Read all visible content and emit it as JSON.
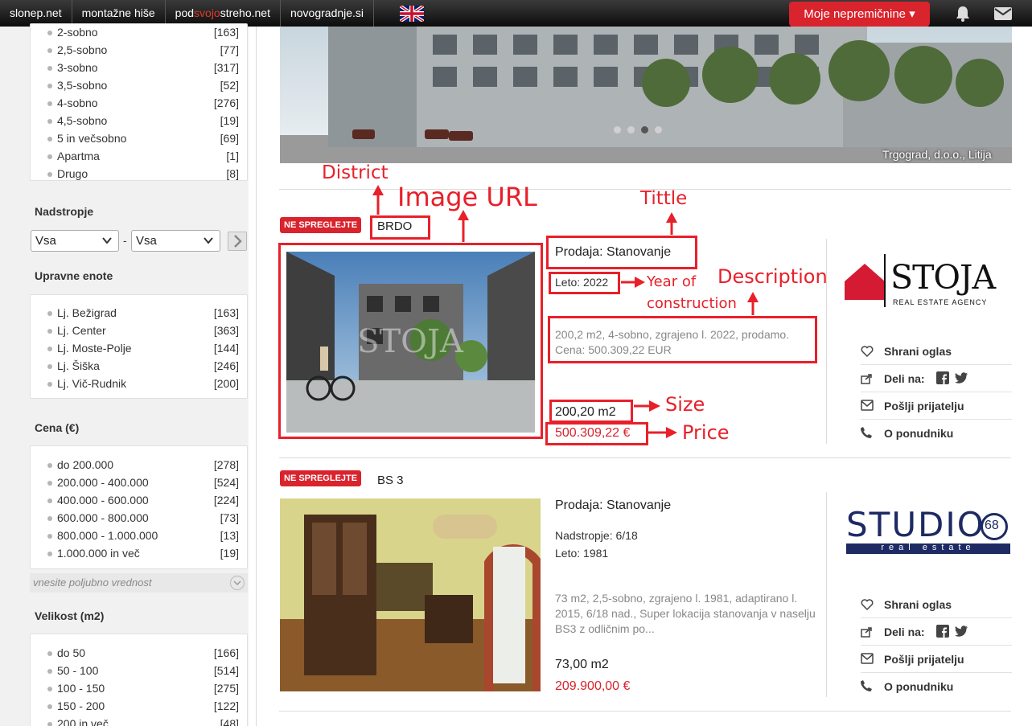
{
  "topbar": {
    "links": [
      "slonep.net",
      "montažne hiše",
      "novogradnje.si"
    ],
    "podsvojo": {
      "a": "pod",
      "b": "svojo",
      "c": "streho.net"
    },
    "moje_label": "Moje nepremičnine",
    "colors": {
      "accent": "#d9232d"
    }
  },
  "sidebar": {
    "room_types": [
      {
        "label": "2-sobno",
        "count": "[163]"
      },
      {
        "label": "2,5-sobno",
        "count": "[77]"
      },
      {
        "label": "3-sobno",
        "count": "[317]"
      },
      {
        "label": "3,5-sobno",
        "count": "[52]"
      },
      {
        "label": "4-sobno",
        "count": "[276]"
      },
      {
        "label": "4,5-sobno",
        "count": "[19]"
      },
      {
        "label": "5 in večsobno",
        "count": "[69]"
      },
      {
        "label": "Apartma",
        "count": "[1]"
      },
      {
        "label": "Drugo",
        "count": "[8]"
      }
    ],
    "floor_heading": "Nadstropje",
    "floor_from": "Vsa",
    "floor_sep": "-",
    "floor_to": "Vsa",
    "admin_heading": "Upravne enote",
    "admin_units": [
      {
        "label": "Lj. Bežigrad",
        "count": "[163]"
      },
      {
        "label": "Lj. Center",
        "count": "[363]"
      },
      {
        "label": "Lj. Moste-Polje",
        "count": "[144]"
      },
      {
        "label": "Lj. Šiška",
        "count": "[246]"
      },
      {
        "label": "Lj. Vič-Rudnik",
        "count": "[200]"
      }
    ],
    "price_heading": "Cena (€)",
    "price_ranges": [
      {
        "label": "do  200.000",
        "count": "[278]"
      },
      {
        "label": "200.000 - 400.000",
        "count": "[524]"
      },
      {
        "label": "400.000 - 600.000",
        "count": "[224]"
      },
      {
        "label": "600.000 - 800.000",
        "count": "[73]"
      },
      {
        "label": "800.000 - 1.000.000",
        "count": "[13]"
      },
      {
        "label": "1.000.000  in več",
        "count": "[19]"
      }
    ],
    "custom_price_placeholder": "vnesite poljubno vrednost",
    "size_heading": "Velikost (m2)",
    "size_ranges": [
      {
        "label": "do  50",
        "count": "[166]"
      },
      {
        "label": "50 - 100",
        "count": "[514]"
      },
      {
        "label": "100 - 150",
        "count": "[275]"
      },
      {
        "label": "150 - 200",
        "count": "[122]"
      },
      {
        "label": "200  in več",
        "count": "[48]"
      }
    ]
  },
  "hero": {
    "credit": "Trgograd, d.o.o., Litija"
  },
  "listings": [
    {
      "badge": "NE SPREGLEJTE",
      "district": "BRDO",
      "title": "Prodaja: Stanovanje",
      "year": "Leto: 2022",
      "description": "200,2 m2, 4-sobno, zgrajeno l. 2022, prodamo. Cena: 500.309,22 EUR",
      "size": "200,20 m2",
      "price": "500.309,22 €",
      "agency": {
        "name": "STOJA",
        "tagline": "REAL ESTATE AGENCY"
      }
    },
    {
      "badge": "NE SPREGLEJTE",
      "district": "BS 3",
      "title": "Prodaja: Stanovanje",
      "floor": "Nadstropje: 6/18",
      "year": "Leto: 1981",
      "description": "73 m2, 2,5-sobno, zgrajeno l. 1981, adaptirano l. 2015, 6/18 nad., Super lokacija stanovanja v naselju BS3 z odličnim po...",
      "size": "73,00 m2",
      "price": "209.900,00 €",
      "agency": {
        "name": "STUDIO",
        "number": "68",
        "tagline": "real estate"
      }
    }
  ],
  "actions": [
    "Shrani oglas",
    "Deli na:",
    "Pošlji prijatelju",
    "O ponudniku"
  ],
  "annotations": {
    "district": "District",
    "image_url": "Image URL",
    "title": "Tittle",
    "year1": "Year of",
    "year2": "construction",
    "description": "Description",
    "size": "Size",
    "price": "Price"
  }
}
